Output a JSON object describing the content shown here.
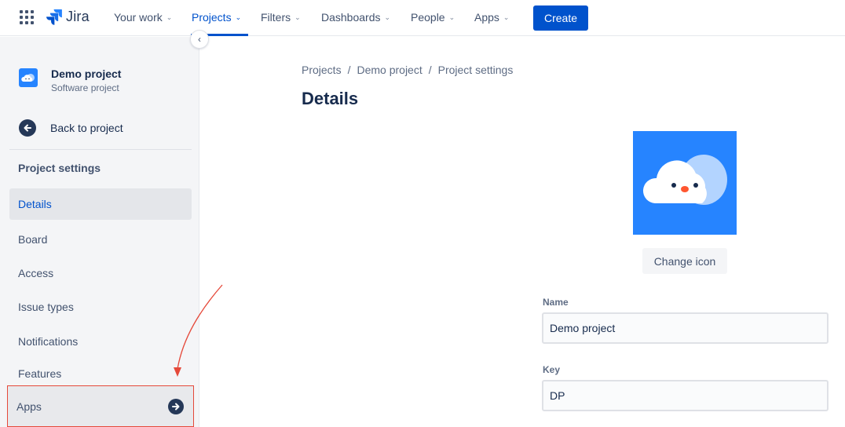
{
  "topnav": {
    "logo_text": "Jira",
    "items": [
      {
        "label": "Your work"
      },
      {
        "label": "Projects"
      },
      {
        "label": "Filters"
      },
      {
        "label": "Dashboards"
      },
      {
        "label": "People"
      },
      {
        "label": "Apps"
      }
    ],
    "active_item": "Projects",
    "create_label": "Create"
  },
  "sidebar": {
    "project_name": "Demo project",
    "project_type": "Software project",
    "back_label": "Back to project",
    "section_title": "Project settings",
    "items": [
      {
        "label": "Details"
      },
      {
        "label": "Board"
      },
      {
        "label": "Access"
      },
      {
        "label": "Issue types"
      },
      {
        "label": "Notifications"
      },
      {
        "label": "Features"
      },
      {
        "label": "Apps"
      }
    ],
    "active_item": "Details",
    "highlighted_item": "Apps"
  },
  "main": {
    "breadcrumb": [
      "Projects",
      "Demo project",
      "Project settings"
    ],
    "title": "Details",
    "change_icon_label": "Change icon",
    "fields": {
      "name_label": "Name",
      "name_value": "Demo project",
      "key_label": "Key",
      "key_value": "DP"
    }
  },
  "colors": {
    "accent": "#0052cc",
    "avatar_bg": "#2684ff",
    "annotation": "#e5493a",
    "sidebar_bg": "#f4f5f7"
  },
  "icons": [
    "app-switcher-icon",
    "jira-logo-icon",
    "chevron-down-icon",
    "cloud-avatar-icon",
    "collapse-chevron-icon",
    "back-arrow-icon",
    "arrow-right-circle-icon"
  ]
}
